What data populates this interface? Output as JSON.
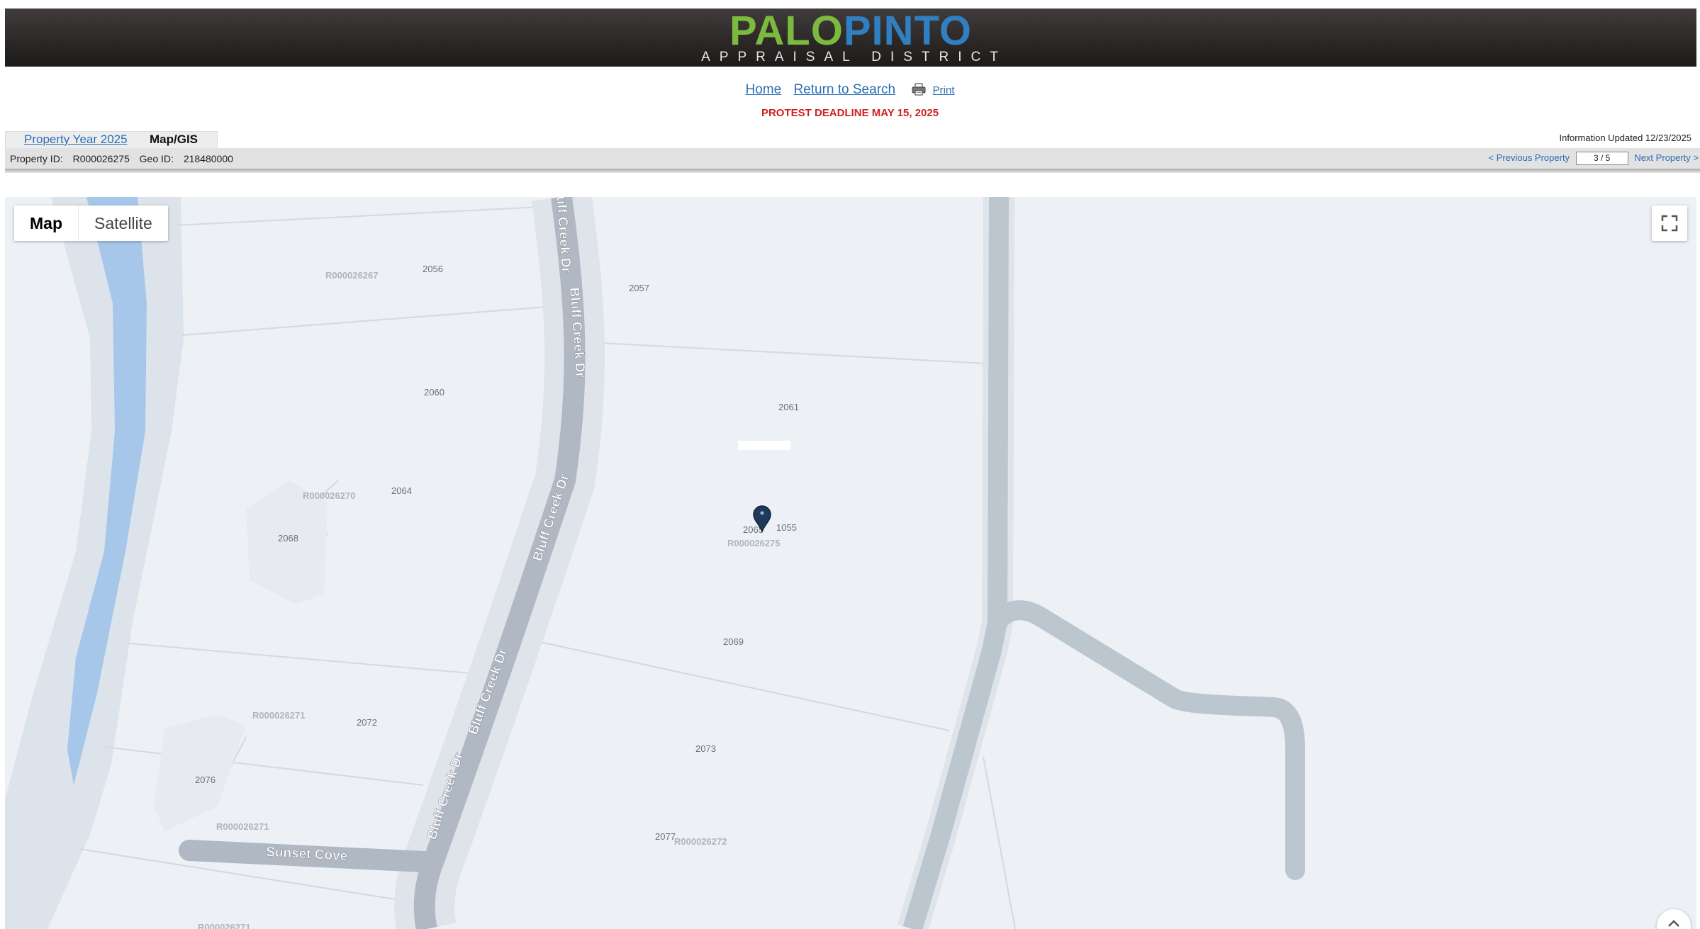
{
  "header": {
    "logo_word1": "PALO",
    "logo_word2": "PINTO",
    "logo_subtitle": "APPRAISAL DISTRICT",
    "colors": {
      "palo": "#7cb93f",
      "pinto": "#2f7fc1"
    }
  },
  "topnav": {
    "home": "Home",
    "return": "Return to Search",
    "print": "Print",
    "print_icon": "printer-icon"
  },
  "deadline": "PROTEST DEADLINE MAY 15, 2025",
  "info_updated": "Information Updated 12/23/2025",
  "tabs": {
    "year": "Property Year 2025",
    "map": "Map/GIS"
  },
  "property": {
    "id_label": "Property ID:",
    "id_value": "R000026275",
    "geo_label": "Geo ID:",
    "geo_value": "218480000"
  },
  "nav": {
    "prev": "< Previous Property",
    "pager": "3 / 5",
    "next": "Next Property >"
  },
  "map": {
    "type_map": "Map",
    "type_satellite": "Satellite",
    "fullscreen_icon": "fullscreen-icon",
    "labels": {
      "r267": "R000026267",
      "r270": "R000026270",
      "r275": "R000026275",
      "r271a": "R000026271",
      "r271b": "R000026271",
      "r271c": "R000026271",
      "r272": "R000026272",
      "n2056": "2056",
      "n2057": "2057",
      "n2060": "2060",
      "n2061": "2061",
      "n2064": "2064",
      "n2065": "2065",
      "n1055": "1055",
      "n2068": "2068",
      "n2069": "2069",
      "n2072": "2072",
      "n2073": "2073",
      "n2076": "2076",
      "n2077": "2077"
    },
    "roads": {
      "bluff_creek": "Bluff Creek Dr",
      "sunset": "Sunset Cove"
    },
    "marker_icon": "map-pin-icon"
  }
}
